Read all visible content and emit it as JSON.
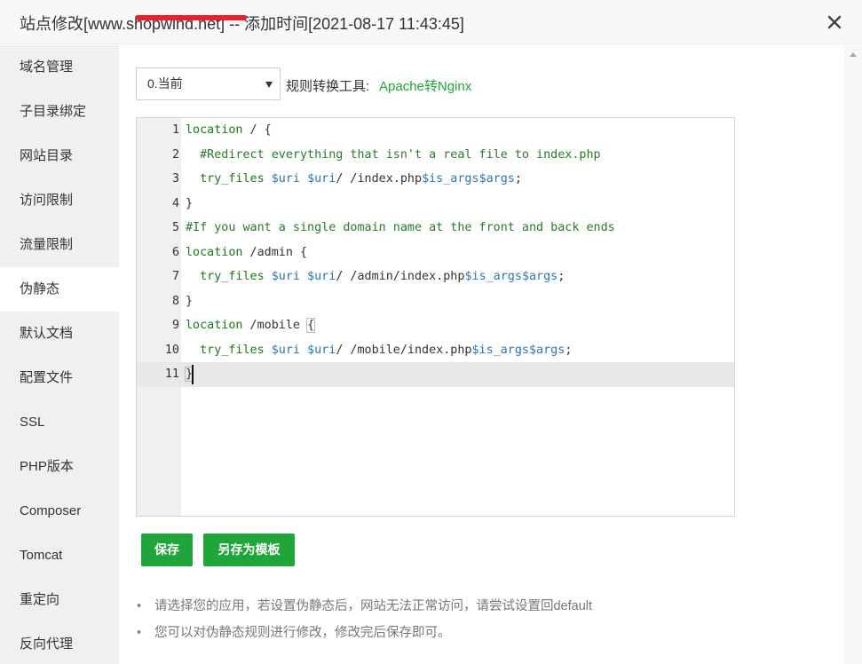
{
  "dialog": {
    "title_prefix": "站点修改[",
    "title_redacted_partial": "www.shopwind",
    "title_suffix": ".net] -- 添加时间[2021-08-17 11:43:45]"
  },
  "sidebar": {
    "items": [
      {
        "label": "域名管理"
      },
      {
        "label": "子目录绑定"
      },
      {
        "label": "网站目录"
      },
      {
        "label": "访问限制"
      },
      {
        "label": "流量限制"
      },
      {
        "label": "伪静态"
      },
      {
        "label": "默认文档"
      },
      {
        "label": "配置文件"
      },
      {
        "label": "SSL"
      },
      {
        "label": "PHP版本"
      },
      {
        "label": "Composer"
      },
      {
        "label": "Tomcat"
      },
      {
        "label": "重定向"
      },
      {
        "label": "反向代理"
      }
    ],
    "active_index": 5
  },
  "toolbar": {
    "select_value": "0.当前",
    "converter_label": "规则转换工具:",
    "converter_link": "Apache转Nginx"
  },
  "editor": {
    "line_numbers": [
      "1",
      "2",
      "3",
      "4",
      "5",
      "6",
      "7",
      "8",
      "9",
      "10",
      "11"
    ],
    "lines": [
      "location / {",
      "  #Redirect everything that isn't a real file to index.php",
      "  try_files $uri $uri/ /index.php$is_args$args;",
      "}",
      "#If you want a single domain name at the front and back ends",
      "location /admin {",
      "  try_files $uri $uri/ /admin/index.php$is_args$args;",
      "}",
      "location /mobile {",
      "  try_files $uri $uri/ /mobile/index.php$is_args$args;",
      "}"
    ],
    "active_line": 11
  },
  "buttons": {
    "save": "保存",
    "save_as_template": "另存为模板"
  },
  "tips": [
    "请选择您的应用，若设置伪静态后，网站无法正常访问，请尝试设置回default",
    "您可以对伪静态规则进行修改，修改完后保存即可。"
  ],
  "colors": {
    "accent_green": "#20a53a",
    "sidebar_bg": "#f0f0f0",
    "redaction": "#e8212c"
  }
}
